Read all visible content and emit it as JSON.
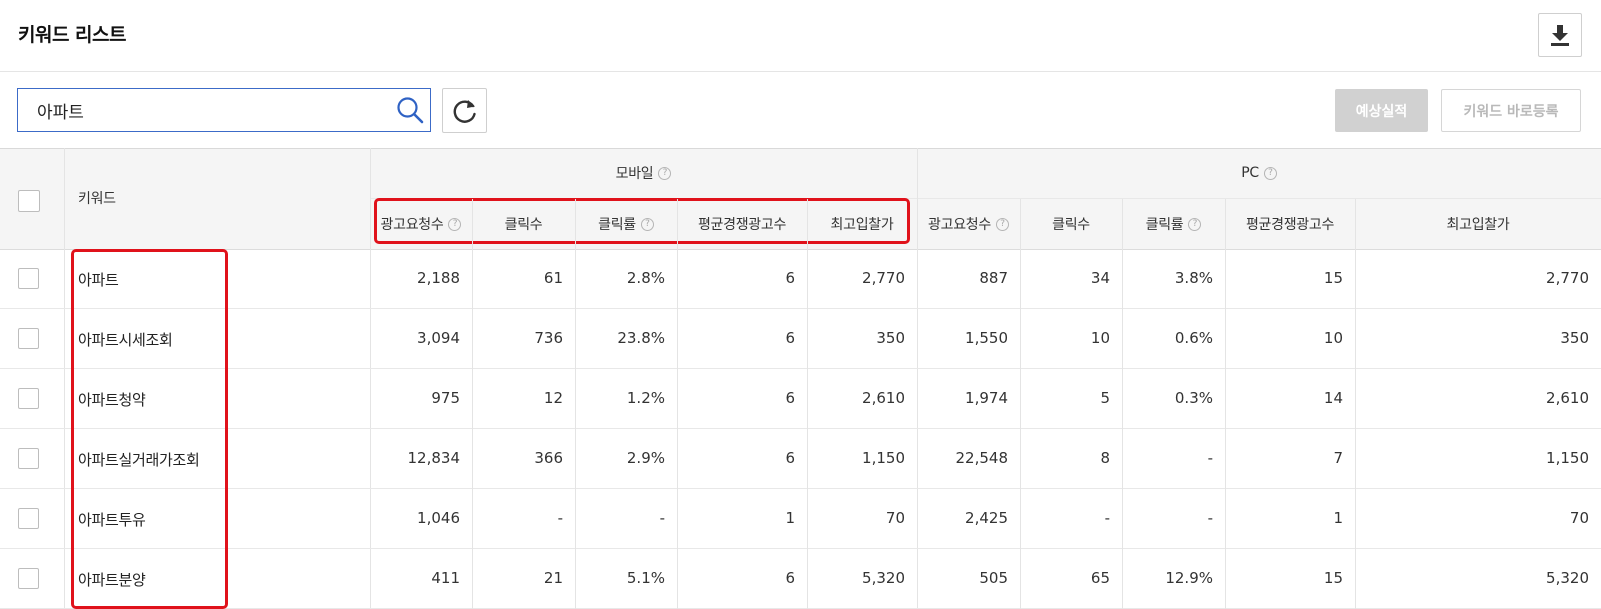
{
  "header": {
    "title": "키워드 리스트",
    "download_icon": "download-icon"
  },
  "search": {
    "value": "아파트",
    "icon": "search-icon"
  },
  "refresh_icon": "refresh-icon",
  "actions": {
    "forecast_label": "예상실적",
    "register_label": "키워드 바로등록"
  },
  "table": {
    "keyword_header": "키워드",
    "groups": {
      "mobile": "모바일",
      "pc": "PC"
    },
    "columns": {
      "impressions": "광고요청수",
      "clicks": "클릭수",
      "ctr": "클릭률",
      "avg_competitors": "평균경쟁광고수",
      "max_bid": "최고입찰가"
    },
    "help_glyph": "?",
    "rows": [
      {
        "keyword": "아파트",
        "m": [
          "2,188",
          "61",
          "2.8%",
          "6",
          "2,770"
        ],
        "p": [
          "887",
          "34",
          "3.8%",
          "15",
          "2,770"
        ]
      },
      {
        "keyword": "아파트시세조회",
        "m": [
          "3,094",
          "736",
          "23.8%",
          "6",
          "350"
        ],
        "p": [
          "1,550",
          "10",
          "0.6%",
          "10",
          "350"
        ]
      },
      {
        "keyword": "아파트청약",
        "m": [
          "975",
          "12",
          "1.2%",
          "6",
          "2,610"
        ],
        "p": [
          "1,974",
          "5",
          "0.3%",
          "14",
          "2,610"
        ]
      },
      {
        "keyword": "아파트실거래가조회",
        "m": [
          "12,834",
          "366",
          "2.9%",
          "6",
          "1,150"
        ],
        "p": [
          "22,548",
          "8",
          "-",
          "7",
          "1,150"
        ]
      },
      {
        "keyword": "아파트투유",
        "m": [
          "1,046",
          "-",
          "-",
          "1",
          "70"
        ],
        "p": [
          "2,425",
          "-",
          "-",
          "1",
          "70"
        ]
      },
      {
        "keyword": "아파트분양",
        "m": [
          "411",
          "21",
          "5.1%",
          "6",
          "5,320"
        ],
        "p": [
          "505",
          "65",
          "12.9%",
          "15",
          "5,320"
        ]
      }
    ]
  },
  "highlight_color": "#e0121b"
}
